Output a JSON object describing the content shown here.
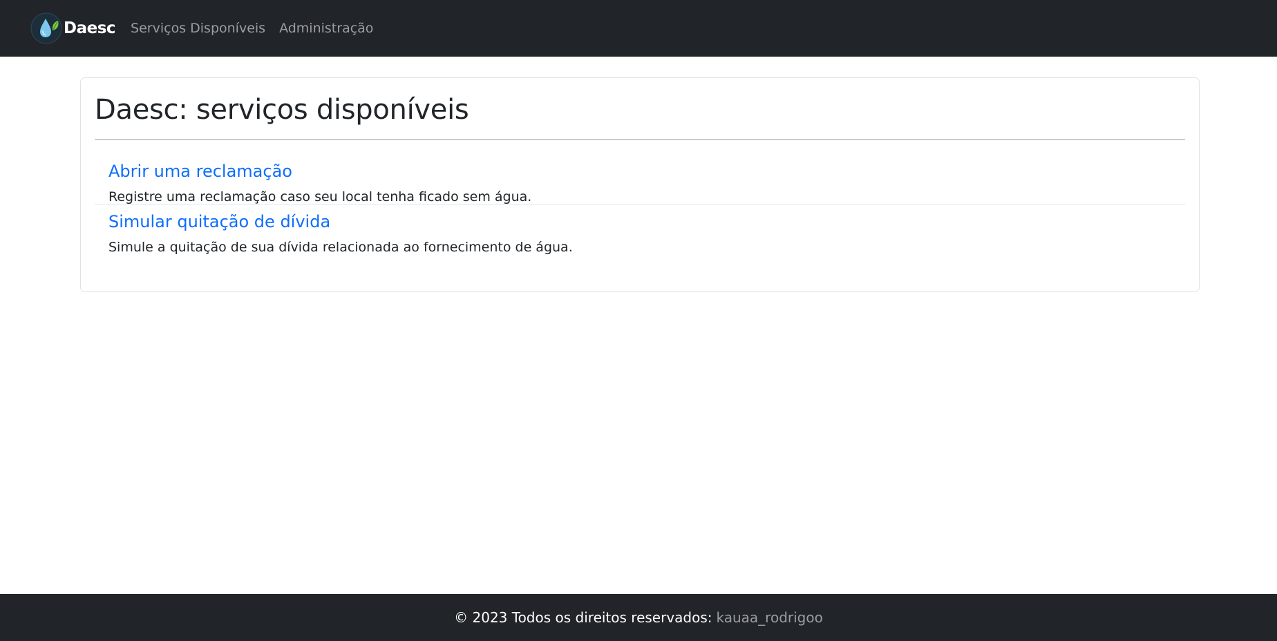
{
  "navbar": {
    "brand": {
      "name": "Daesc",
      "logo_icon": "water-drop-leaf-logo"
    },
    "links": [
      {
        "label": "Serviços Disponíveis"
      },
      {
        "label": "Administração"
      }
    ]
  },
  "main": {
    "title": "Daesc: serviços disponíveis",
    "services": [
      {
        "title": "Abrir uma reclamação",
        "description": "Registre uma reclamação caso seu local tenha ficado sem água."
      },
      {
        "title": "Simular quitação de dívida",
        "description": "Simule a quitação de sua dívida relacionada ao fornecimento de água."
      }
    ]
  },
  "footer": {
    "text": "© 2023 Todos os direitos reservados:",
    "author": "kauaa_rodrigoo"
  },
  "colors": {
    "navbar_bg": "#212529",
    "link_blue": "#0d6efd",
    "logo_drop": "#7cc8ec",
    "logo_leaf": "#7ac943"
  }
}
